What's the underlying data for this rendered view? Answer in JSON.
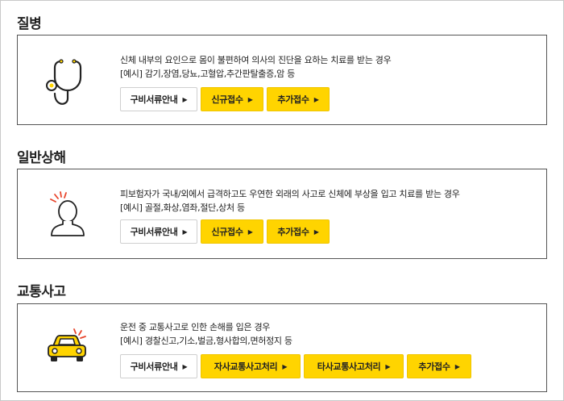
{
  "sections": [
    {
      "title": "질병",
      "icon": "stethoscope-icon",
      "description": "신체 내부의 요인으로 몸이 불편하여 의사의 진단을 요하는 치료를 받는 경우",
      "example": "[예시] 감기,장염,당뇨,고혈압,추간판탈출증,암 등",
      "buttons": [
        "구비서류안내",
        "신규접수",
        "추가접수"
      ]
    },
    {
      "title": "일반상해",
      "icon": "injured-person-icon",
      "description": "피보험자가 국내/외에서 급격하고도 우연한 외래의 사고로 신체에 부상을 입고 치료를 받는 경우",
      "example": "[예시] 골절,화상,염좌,절단,상처 등",
      "buttons": [
        "구비서류안내",
        "신규접수",
        "추가접수"
      ]
    },
    {
      "title": "교통사고",
      "icon": "car-accident-icon",
      "description": "운전 중 교통사고로 인한 손해를 입은 경우",
      "example": "[예시] 경찰신고,기소,벌금,형사합의,면허정지 등",
      "buttons": [
        "구비서류안내",
        "자사교통사고처리",
        "타사교통사고처리",
        "추가접수"
      ]
    }
  ],
  "colors": {
    "accent": "#ffd400",
    "border": "#555555",
    "alert": "#e8452c"
  }
}
